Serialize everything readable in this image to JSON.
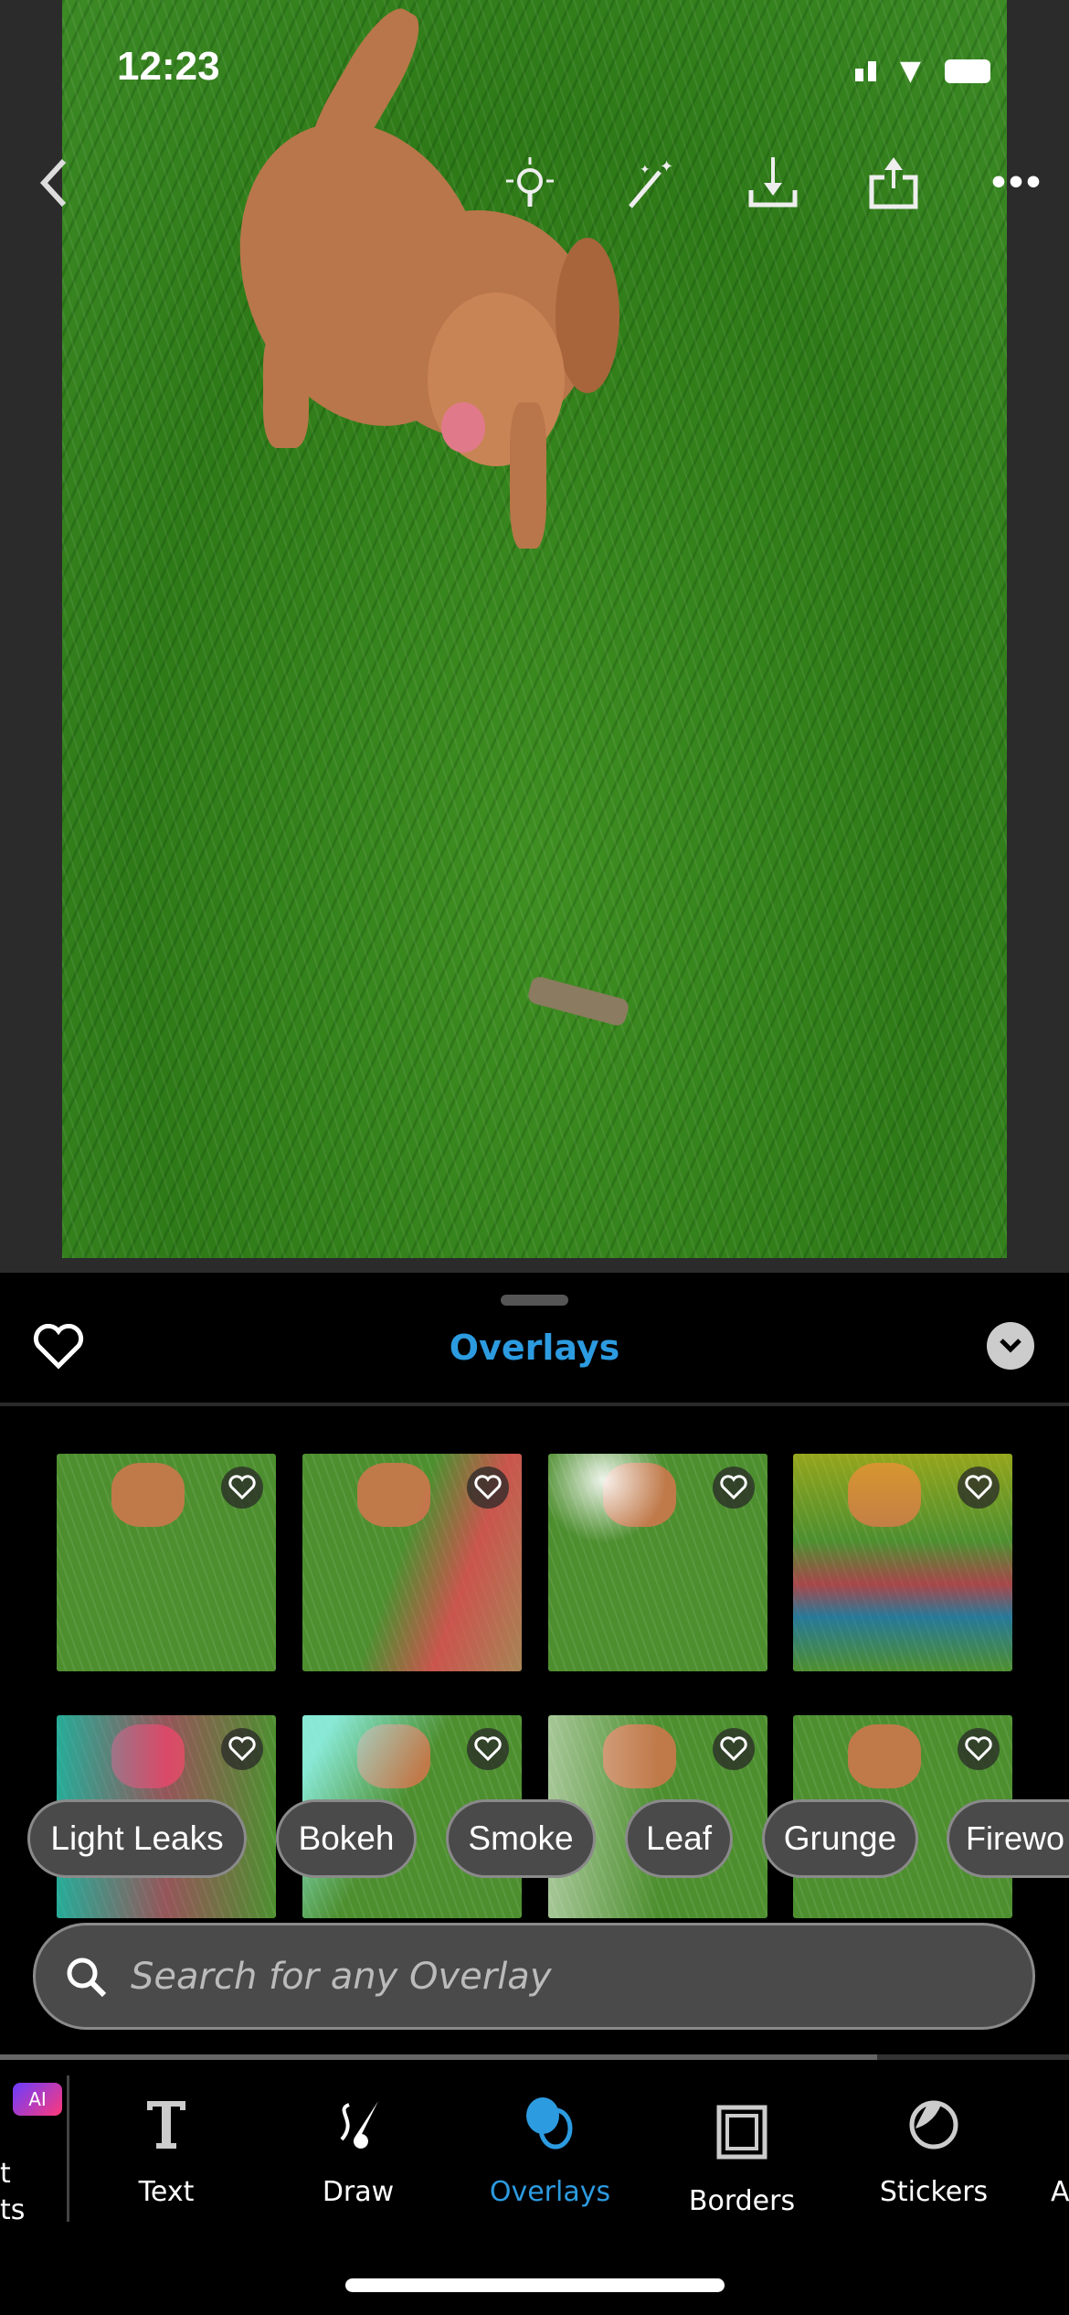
{
  "status_bar": {
    "time": "12:23"
  },
  "top_toolbar": {
    "icons": [
      "back-icon",
      "lightbulb-icon",
      "magic-wand-icon",
      "download-icon",
      "share-icon",
      "more-icon"
    ]
  },
  "panel": {
    "title": "Overlays"
  },
  "thumbnails": [
    {
      "tint": "none"
    },
    {
      "tint": "red-leak"
    },
    {
      "tint": "flare"
    },
    {
      "tint": "rainbow"
    },
    {
      "tint": "rainbow-left"
    },
    {
      "tint": "cyan-beam"
    },
    {
      "tint": "white-leak"
    },
    {
      "tint": "plain"
    }
  ],
  "chips": [
    "Light Leaks",
    "Bokeh",
    "Smoke",
    "Leaf",
    "Grunge",
    "Firewo"
  ],
  "search": {
    "placeholder": "Search for any Overlay"
  },
  "tools": {
    "partial_left": "t\nts",
    "ai_badge": "AI",
    "items": [
      "Text",
      "Draw",
      "Overlays",
      "Borders",
      "Stickers",
      "A"
    ],
    "active": "Overlays"
  },
  "colors": {
    "accent": "#2c9be0"
  }
}
